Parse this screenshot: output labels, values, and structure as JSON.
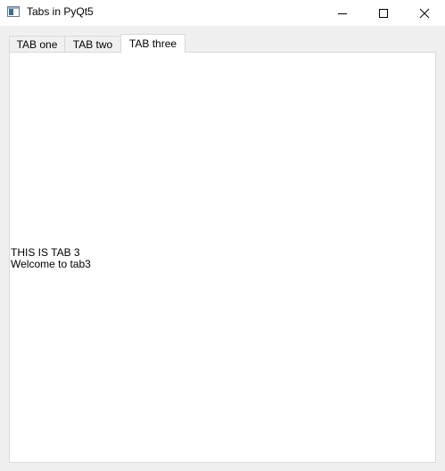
{
  "window": {
    "title": "Tabs in PyQt5",
    "icon": "app-window-icon"
  },
  "controls": {
    "minimize_icon": "minimize-icon",
    "maximize_icon": "maximize-icon",
    "close_icon": "close-icon"
  },
  "tabs": [
    {
      "label": "TAB one",
      "selected": false
    },
    {
      "label": "TAB two",
      "selected": false
    },
    {
      "label": "TAB three",
      "selected": true
    }
  ],
  "content": {
    "line1": "THIS IS TAB 3",
    "line2": "Welcome to tab3"
  }
}
